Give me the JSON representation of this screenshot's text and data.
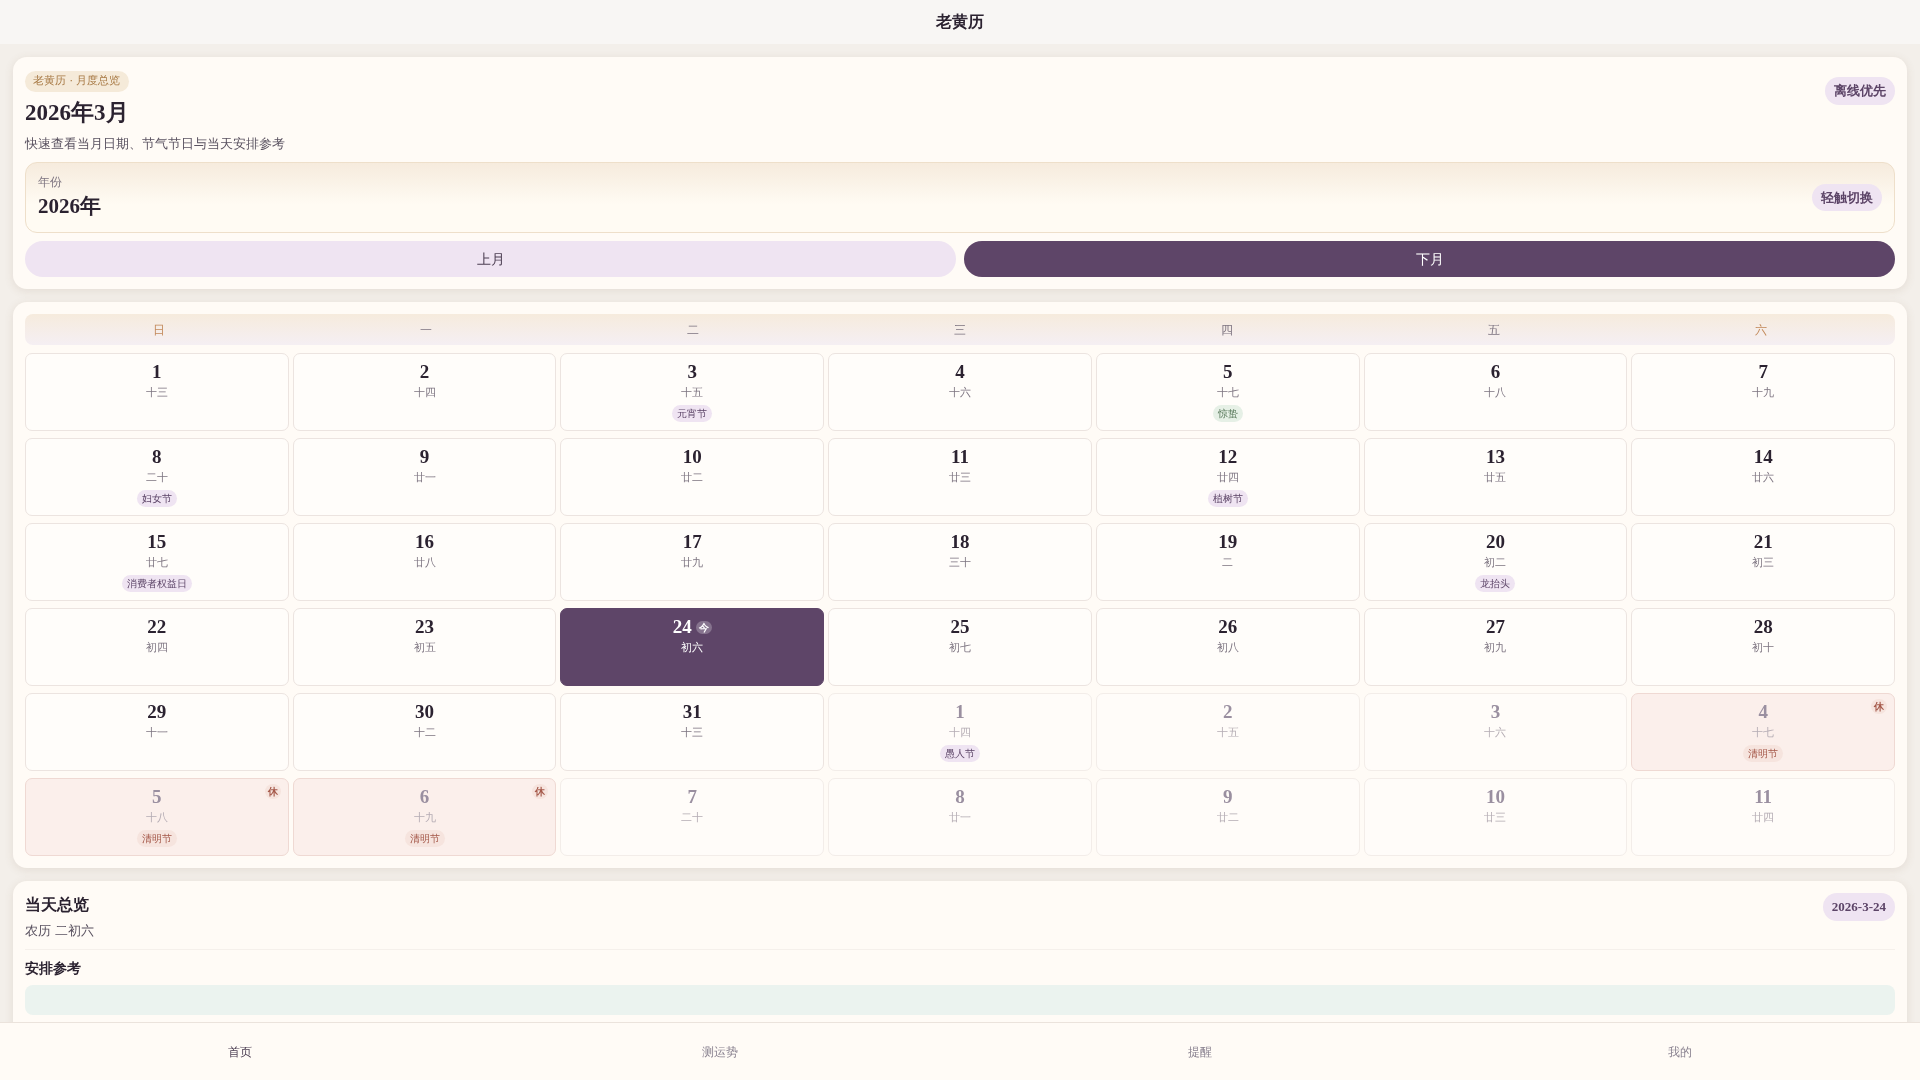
{
  "app_title": "老黄历",
  "header": {
    "badge": "老黄历 · 月度总览",
    "title": "2026年3月",
    "subtitle": "快速查看当月日期、节气节日与当天安排参考",
    "mode_badge": "离线优先"
  },
  "year_picker": {
    "label": "年份",
    "value": "2026年",
    "hint": "轻触切换"
  },
  "nav_buttons": [
    {
      "label": "上月",
      "primary": false
    },
    {
      "label": "下月",
      "primary": true
    }
  ],
  "weekdays": [
    {
      "label": "日",
      "weekend": true
    },
    {
      "label": "一",
      "weekend": false
    },
    {
      "label": "二",
      "weekend": false
    },
    {
      "label": "三",
      "weekend": false
    },
    {
      "label": "四",
      "weekend": false
    },
    {
      "label": "五",
      "weekend": false
    },
    {
      "label": "六",
      "weekend": true
    }
  ],
  "days": [
    {
      "day": "1",
      "lunar": "十三",
      "in_month": true,
      "today": false,
      "rest": false
    },
    {
      "day": "2",
      "lunar": "十四",
      "in_month": true,
      "today": false,
      "rest": false
    },
    {
      "day": "3",
      "lunar": "十五",
      "in_month": true,
      "today": false,
      "rest": false,
      "tag": {
        "text": "元宵节",
        "kind": "festival"
      }
    },
    {
      "day": "4",
      "lunar": "十六",
      "in_month": true,
      "today": false,
      "rest": false
    },
    {
      "day": "5",
      "lunar": "十七",
      "in_month": true,
      "today": false,
      "rest": false,
      "tag": {
        "text": "惊蛰",
        "kind": "term"
      }
    },
    {
      "day": "6",
      "lunar": "十八",
      "in_month": true,
      "today": false,
      "rest": false
    },
    {
      "day": "7",
      "lunar": "十九",
      "in_month": true,
      "today": false,
      "rest": false
    },
    {
      "day": "8",
      "lunar": "二十",
      "in_month": true,
      "today": false,
      "rest": false,
      "tag": {
        "text": "妇女节",
        "kind": "festival"
      }
    },
    {
      "day": "9",
      "lunar": "廿一",
      "in_month": true,
      "today": false,
      "rest": false
    },
    {
      "day": "10",
      "lunar": "廿二",
      "in_month": true,
      "today": false,
      "rest": false
    },
    {
      "day": "11",
      "lunar": "廿三",
      "in_month": true,
      "today": false,
      "rest": false
    },
    {
      "day": "12",
      "lunar": "廿四",
      "in_month": true,
      "today": false,
      "rest": false,
      "tag": {
        "text": "植树节",
        "kind": "festival"
      }
    },
    {
      "day": "13",
      "lunar": "廿五",
      "in_month": true,
      "today": false,
      "rest": false
    },
    {
      "day": "14",
      "lunar": "廿六",
      "in_month": true,
      "today": false,
      "rest": false
    },
    {
      "day": "15",
      "lunar": "廿七",
      "in_month": true,
      "today": false,
      "rest": false,
      "tag": {
        "text": "消费者权益日",
        "kind": "festival"
      }
    },
    {
      "day": "16",
      "lunar": "廿八",
      "in_month": true,
      "today": false,
      "rest": false
    },
    {
      "day": "17",
      "lunar": "廿九",
      "in_month": true,
      "today": false,
      "rest": false
    },
    {
      "day": "18",
      "lunar": "三十",
      "in_month": true,
      "today": false,
      "rest": false
    },
    {
      "day": "19",
      "lunar": "二",
      "in_month": true,
      "today": false,
      "rest": false
    },
    {
      "day": "20",
      "lunar": "初二",
      "in_month": true,
      "today": false,
      "rest": false,
      "tag": {
        "text": "龙抬头",
        "kind": "festival"
      }
    },
    {
      "day": "21",
      "lunar": "初三",
      "in_month": true,
      "today": false,
      "rest": false
    },
    {
      "day": "22",
      "lunar": "初四",
      "in_month": true,
      "today": false,
      "rest": false
    },
    {
      "day": "23",
      "lunar": "初五",
      "in_month": true,
      "today": false,
      "rest": false
    },
    {
      "day": "24",
      "lunar": "初六",
      "in_month": true,
      "today": true,
      "today_mark": "今",
      "rest": false
    },
    {
      "day": "25",
      "lunar": "初七",
      "in_month": true,
      "today": false,
      "rest": false
    },
    {
      "day": "26",
      "lunar": "初八",
      "in_month": true,
      "today": false,
      "rest": false
    },
    {
      "day": "27",
      "lunar": "初九",
      "in_month": true,
      "today": false,
      "rest": false
    },
    {
      "day": "28",
      "lunar": "初十",
      "in_month": true,
      "today": false,
      "rest": false
    },
    {
      "day": "29",
      "lunar": "十一",
      "in_month": true,
      "today": false,
      "rest": false
    },
    {
      "day": "30",
      "lunar": "十二",
      "in_month": true,
      "today": false,
      "rest": false
    },
    {
      "day": "31",
      "lunar": "十三",
      "in_month": true,
      "today": false,
      "rest": false
    },
    {
      "day": "1",
      "lunar": "十四",
      "in_month": false,
      "today": false,
      "rest": false,
      "tag": {
        "text": "愚人节",
        "kind": "festival"
      }
    },
    {
      "day": "2",
      "lunar": "十五",
      "in_month": false,
      "today": false,
      "rest": false
    },
    {
      "day": "3",
      "lunar": "十六",
      "in_month": false,
      "today": false,
      "rest": false
    },
    {
      "day": "4",
      "lunar": "十七",
      "in_month": false,
      "today": false,
      "rest": true,
      "rest_mark": "休",
      "tag": {
        "text": "清明节",
        "kind": "holiday"
      }
    },
    {
      "day": "5",
      "lunar": "十八",
      "in_month": false,
      "today": false,
      "rest": true,
      "rest_mark": "休",
      "tag": {
        "text": "清明节",
        "kind": "holiday"
      }
    },
    {
      "day": "6",
      "lunar": "十九",
      "in_month": false,
      "today": false,
      "rest": true,
      "rest_mark": "休",
      "tag": {
        "text": "清明节",
        "kind": "holiday"
      }
    },
    {
      "day": "7",
      "lunar": "二十",
      "in_month": false,
      "today": false,
      "rest": false
    },
    {
      "day": "8",
      "lunar": "廿一",
      "in_month": false,
      "today": false,
      "rest": false
    },
    {
      "day": "9",
      "lunar": "廿二",
      "in_month": false,
      "today": false,
      "rest": false
    },
    {
      "day": "10",
      "lunar": "廿三",
      "in_month": false,
      "today": false,
      "rest": false
    },
    {
      "day": "11",
      "lunar": "廿四",
      "in_month": false,
      "today": false,
      "rest": false
    }
  ],
  "overview": {
    "title": "当天总览",
    "lunar": "农历 二初六",
    "date": "2026-3-24",
    "section_title": "安排参考"
  },
  "tab_bar": [
    {
      "label": "首页",
      "selected": true
    },
    {
      "label": "测运势",
      "selected": false
    },
    {
      "label": "提醒",
      "selected": false
    },
    {
      "label": "我的",
      "selected": false
    }
  ]
}
